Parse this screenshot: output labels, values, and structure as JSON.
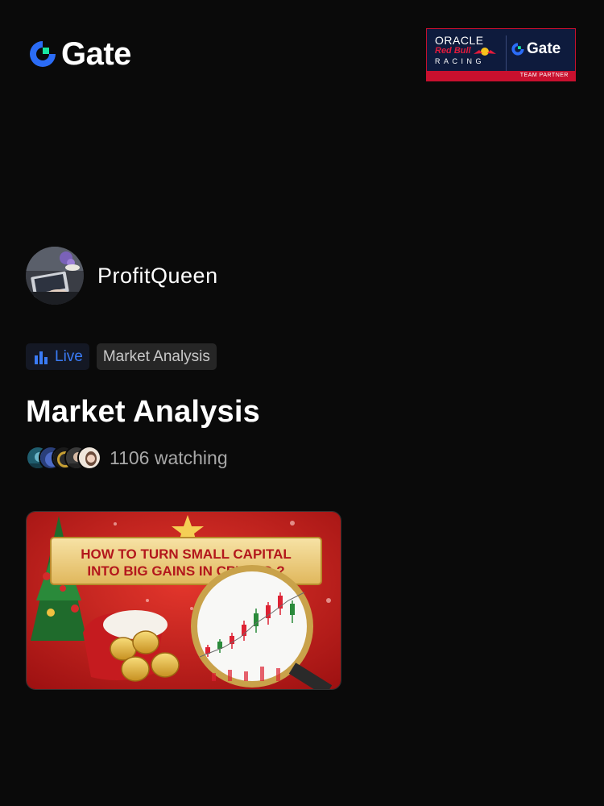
{
  "brand": {
    "name": "Gate"
  },
  "partner_badge": {
    "oracle": "ORACLE",
    "red_bull": "Red Bull",
    "racing": "RACING",
    "gate": "Gate",
    "caption": "TEAM PARTNER"
  },
  "host": {
    "name": "ProfitQueen"
  },
  "tags": {
    "live": "Live",
    "category": "Market Analysis"
  },
  "stream": {
    "title": "Market Analysis",
    "watching": "1106 watching"
  },
  "thumbnail": {
    "headline_line1": "HOW TO TURN SMALL CAPITAL",
    "headline_line2": "INTO BIG GAINS IN CRYPTO ?"
  },
  "colors": {
    "background": "#0a0a0a",
    "accent_blue": "#3a7bf5",
    "brand_green": "#17e6a1",
    "partner_red": "#c8102e",
    "partner_navy": "#0e1b3d"
  }
}
